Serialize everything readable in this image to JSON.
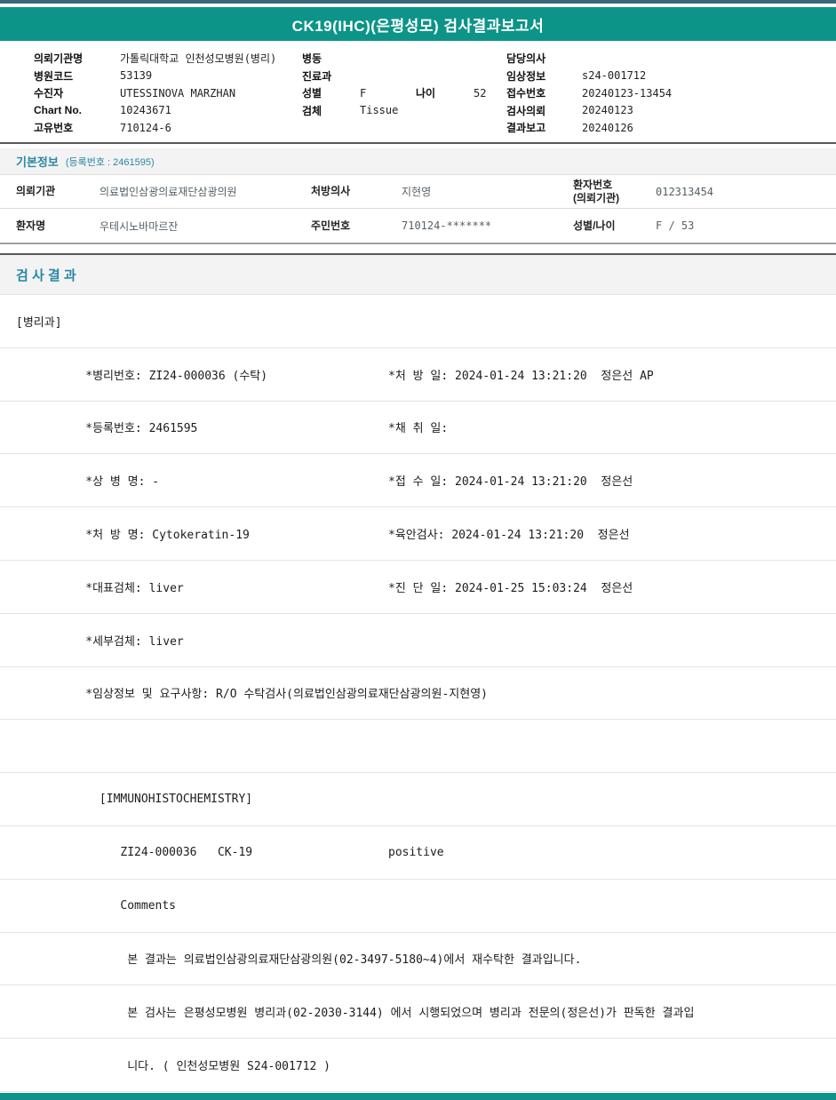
{
  "page": {
    "title": "CK19(IHC)(은평성모) 검사결과보고서",
    "accent_color": "#0d9488",
    "section_title_color": "#2b87a6"
  },
  "patient_header": {
    "left": [
      {
        "label": "의뢰기관명",
        "value": "가톨릭대학교 인천성모병원(병리)"
      },
      {
        "label": "병원코드",
        "value": "53139"
      },
      {
        "label": "수진자",
        "value": "UTESSINOVA MARZHAN"
      },
      {
        "label": "Chart No.",
        "value": "10243671"
      },
      {
        "label": "고유번호",
        "value": "710124-6"
      }
    ],
    "mid": {
      "ward_label": "병동",
      "ward_value": "",
      "dept_label": "진료과",
      "dept_value": "",
      "sex_label": "성별",
      "sex_value": "F",
      "age_label": "나이",
      "age_value": "52",
      "specimen_label": "검체",
      "specimen_value": "Tissue"
    },
    "right": [
      {
        "label": "담당의사",
        "value": ""
      },
      {
        "label": "임상정보",
        "value": "s24-001712"
      },
      {
        "label": "접수번호",
        "value": "20240123-13454"
      },
      {
        "label": "검사의뢰",
        "value": "20240123"
      },
      {
        "label": "결과보고",
        "value": "20240126"
      }
    ]
  },
  "basic_info": {
    "title": "기본정보",
    "subtitle": "(등록번호 : 2461595)",
    "row1": {
      "l1": "의뢰기관",
      "v1": "의료법인삼광의료재단삼광의원",
      "l2": "처방의사",
      "v2": "지현영",
      "l3": "환자번호\n(의뢰기관)",
      "v3": "012313454"
    },
    "row2": {
      "l1": "환자명",
      "v1": "우테시노바마르잔",
      "l2": "주민번호",
      "v2": "710124-*******",
      "l3": "성별/나이",
      "v3": "F / 53"
    }
  },
  "results": {
    "title": "검 사 결 과",
    "rows": [
      {
        "left": "[병리과]",
        "right": ""
      },
      {
        "left": "          *병리번호: ZI24-000036 (수탁)",
        "right": "*처 방 일: 2024-01-24 13:21:20  정은선 AP"
      },
      {
        "left": "          *등록번호: 2461595",
        "right": "*채 취 일:"
      },
      {
        "left": "          *상 병 명: -",
        "right": "*접 수 일: 2024-01-24 13:21:20  정은선"
      },
      {
        "left": "          *처 방 명: Cytokeratin-19",
        "right": "*육안검사: 2024-01-24 13:21:20  정은선"
      },
      {
        "left": "          *대표검체: liver",
        "right": "*진 단 일: 2024-01-25 15:03:24  정은선"
      },
      {
        "left": "          *세부검체: liver",
        "right": ""
      },
      {
        "left": "          *임상정보 및 요구사항: R/O 수탁검사(의료법인삼광의료재단삼광의원-지현영)",
        "right": ""
      },
      {
        "left": "",
        "right": ""
      },
      {
        "left": "            [IMMUNOHISTOCHEMISTRY]",
        "right": ""
      },
      {
        "left": "               ZI24-000036   CK-19",
        "right": "positive"
      },
      {
        "left": "               Comments",
        "right": ""
      },
      {
        "left": "                본 결과는 의료법인삼광의료재단삼광의원(02-3497-5180~4)에서 재수탁한 결과입니다.",
        "right": ""
      },
      {
        "left": "                본 검사는 은평성모병원 병리과(02-2030-3144) 에서 시행되었으며 병리과 전문의(정은선)가 판독한 결과입",
        "right": ""
      },
      {
        "left": "                니다. ( 인천성모병원 S24-001712 )",
        "right": ""
      }
    ]
  }
}
